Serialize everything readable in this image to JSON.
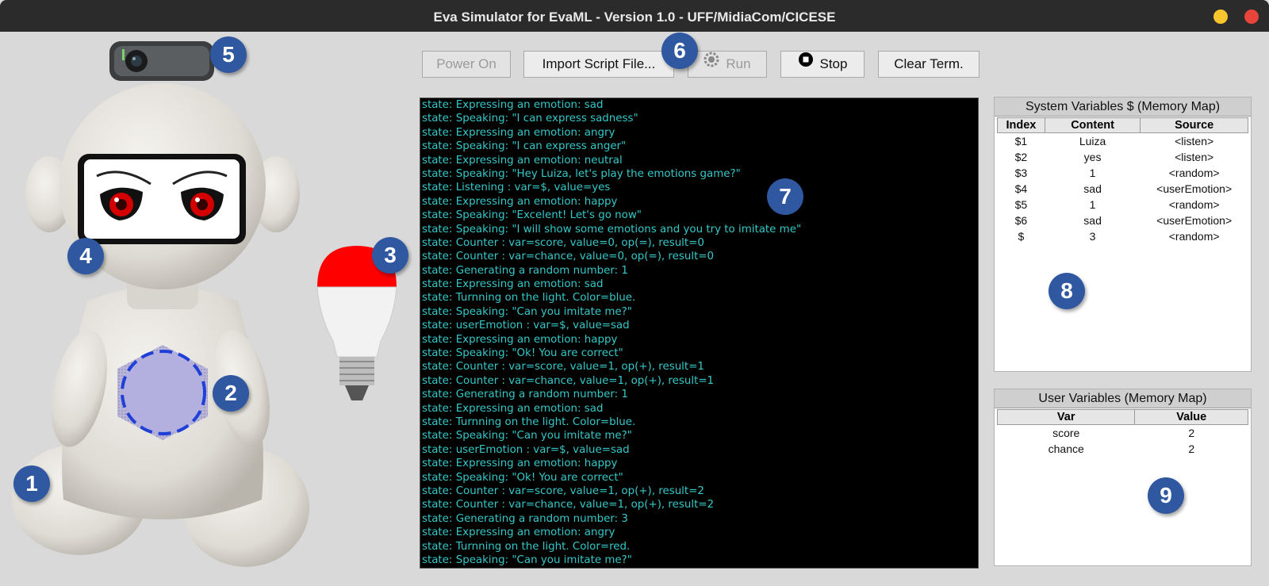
{
  "window": {
    "title": "Eva Simulator for EvaML - Version 1.0 - UFF/MidiaCom/CICESE"
  },
  "toolbar": {
    "power_on": "Power On",
    "import": "Import Script File...",
    "run": "Run",
    "stop": "Stop",
    "clear": "Clear Term."
  },
  "terminal": {
    "lines": [
      "state: Expressing an emotion: sad",
      "state: Speaking: \"I can express sadness\"",
      "state: Expressing an emotion: angry",
      "state: Speaking: \"I can express anger\"",
      "state: Expressing an emotion: neutral",
      "state: Speaking: \"Hey Luiza, let's play the emotions game?\"",
      "state: Listening : var=$, value=yes",
      "state: Expressing an emotion: happy",
      "state: Speaking: \"Excelent! Let's go now\"",
      "state: Speaking: \"I will show some emotions and you try to imitate me\"",
      "state: Counter : var=score, value=0, op(=), result=0",
      "state: Counter : var=chance, value=0, op(=), result=0",
      "state: Generating a random number: 1",
      "state: Expressing an emotion: sad",
      "state: Turnning on the light. Color=blue.",
      "state: Speaking: \"Can you imitate me?\"",
      "state: userEmotion : var=$, value=sad",
      "state: Expressing an emotion: happy",
      "state: Speaking: \"Ok! You are correct\"",
      "state: Counter : var=score, value=1, op(+), result=1",
      "state: Counter : var=chance, value=1, op(+), result=1",
      "state: Generating a random number: 1",
      "state: Expressing an emotion: sad",
      "state: Turnning on the light. Color=blue.",
      "state: Speaking: \"Can you imitate me?\"",
      "state: userEmotion : var=$, value=sad",
      "state: Expressing an emotion: happy",
      "state: Speaking: \"Ok! You are correct\"",
      "state: Counter : var=score, value=1, op(+), result=2",
      "state: Counter : var=chance, value=1, op(+), result=2",
      "state: Generating a random number: 3",
      "state: Expressing an emotion: angry",
      "state: Turnning on the light. Color=red.",
      "state: Speaking: \"Can you imitate me?\""
    ]
  },
  "system_vars": {
    "title": "System Variables $ (Memory Map)",
    "headers": [
      "Index",
      "Content",
      "Source"
    ],
    "rows": [
      [
        "$1",
        "Luiza",
        "<listen>"
      ],
      [
        "$2",
        "yes",
        "<listen>"
      ],
      [
        "$3",
        "1",
        "<random>"
      ],
      [
        "$4",
        "sad",
        "<userEmotion>"
      ],
      [
        "$5",
        "1",
        "<random>"
      ],
      [
        "$6",
        "sad",
        "<userEmotion>"
      ],
      [
        "$",
        "3",
        "<random>"
      ]
    ]
  },
  "user_vars": {
    "title": "User Variables (Memory Map)",
    "headers": [
      "Var",
      "Value"
    ],
    "rows": [
      [
        "score",
        "2"
      ],
      [
        "chance",
        "2"
      ]
    ]
  },
  "badges": [
    "1",
    "2",
    "3",
    "4",
    "5",
    "6",
    "7",
    "8",
    "9"
  ],
  "colors": {
    "light": "#ff0000",
    "terminal_text": "#36c8c8",
    "badge": "#2f58a0",
    "eyes": "#d40000",
    "speaker_ring": "#1f3fd6"
  },
  "icons": {
    "run": "run-gear-icon",
    "stop": "stop-record-icon"
  }
}
